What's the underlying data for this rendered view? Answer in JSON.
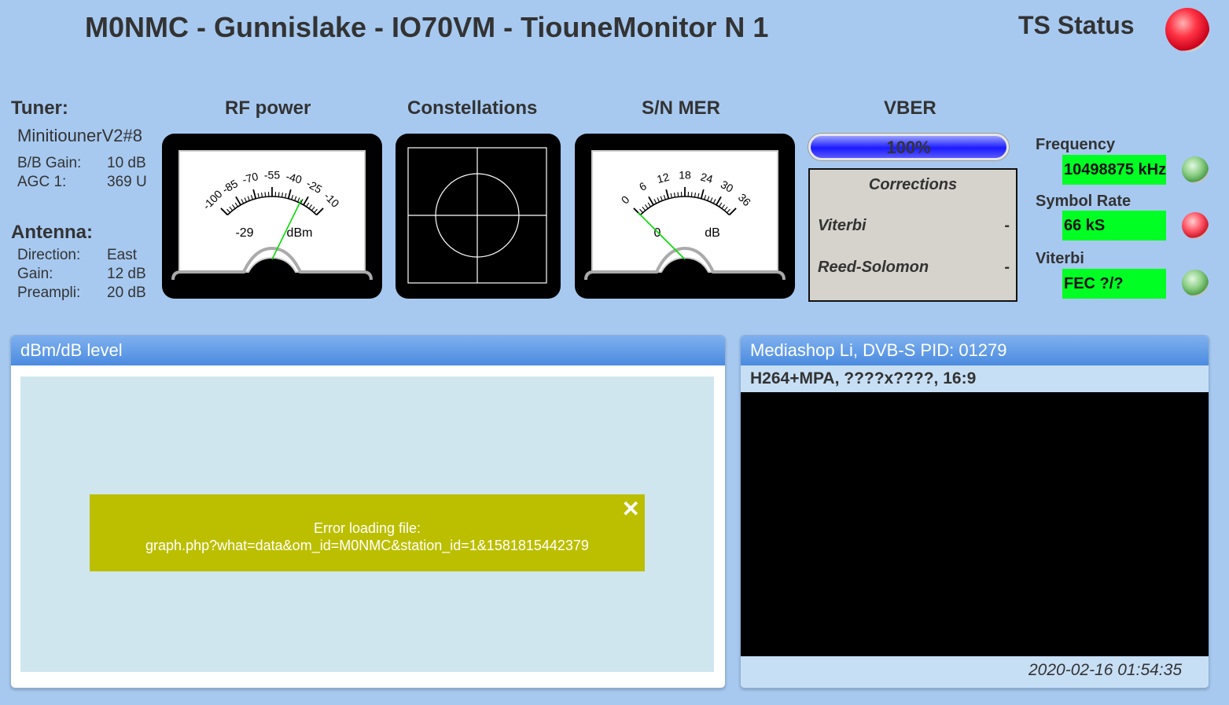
{
  "header": {
    "title": "M0NMC - Gunnislake - IO70VM - TiouneMonitor N 1",
    "ts_status_label": "TS Status",
    "ts_status_color": "#ff3344"
  },
  "tuner": {
    "heading": "Tuner:",
    "name": "MinitiounerV2#8",
    "rows": [
      {
        "label": "B/B Gain:",
        "value": "10 dB"
      },
      {
        "label": "AGC 1:",
        "value": "369 U"
      }
    ]
  },
  "antenna": {
    "heading": "Antenna:",
    "rows": [
      {
        "label": "Direction:",
        "value": "East"
      },
      {
        "label": "Gain:",
        "value": "12 dB"
      },
      {
        "label": "Preampli:",
        "value": "20 dB"
      }
    ]
  },
  "rf_meter": {
    "title": "RF power",
    "ticks": [
      "-100",
      "-85",
      "-70",
      "-55",
      "-40",
      "-25",
      "-10"
    ],
    "readout": "-29",
    "unit": "dBm",
    "needle_fraction": 0.79
  },
  "constellation": {
    "title": "Constellations"
  },
  "mer_meter": {
    "title": "S/N MER",
    "ticks": [
      "0",
      "6",
      "12",
      "18",
      "24",
      "30",
      "36"
    ],
    "readout": "0",
    "unit": "dB",
    "needle_fraction": 0.0
  },
  "vber": {
    "title": "VBER",
    "percent_text": "100%",
    "percent": 100,
    "corrections_title": "Corrections",
    "rows": [
      {
        "label": "Viterbi",
        "value": "-"
      },
      {
        "label": "Reed-Solomon",
        "value": "-"
      }
    ]
  },
  "status": [
    {
      "label": "Frequency",
      "value": "10498875 kHz",
      "led": "green"
    },
    {
      "label": "Symbol Rate",
      "value": "66 kS",
      "led": "red"
    },
    {
      "label": "Viterbi",
      "value": "FEC ?/?",
      "led": "green"
    }
  ],
  "graph_panel": {
    "title": "dBm/dB level",
    "error_line1": "Error loading file:",
    "error_line2": "graph.php?what=data&om_id=M0NMC&station_id=1&1581815442379",
    "close_glyph": "✕"
  },
  "video_panel": {
    "title": "Mediashop Li, DVB-S PID: 01279",
    "info": "H264+MPA, ????x????, 16:9",
    "timestamp": "2020-02-16 01:54:35"
  }
}
